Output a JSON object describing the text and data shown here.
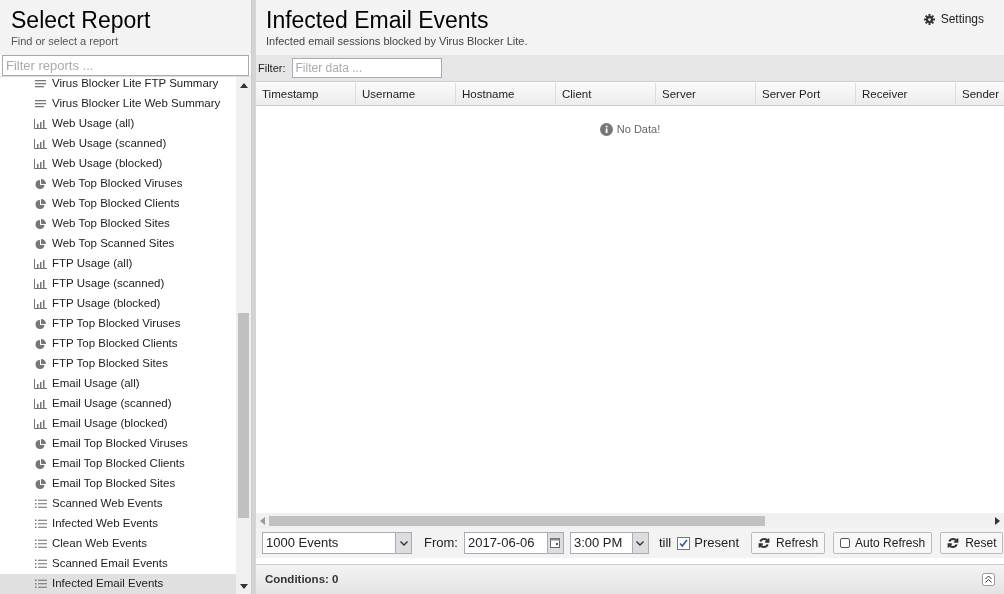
{
  "sidebar": {
    "title": "Select Report",
    "subtitle": "Find or select a report",
    "filter": {
      "placeholder": "Filter reports ..."
    },
    "items": [
      {
        "label": "Virus Blocker Lite FTP Summary",
        "kind": "summary",
        "selected": false
      },
      {
        "label": "Virus Blocker Lite Web Summary",
        "kind": "summary",
        "selected": false
      },
      {
        "label": "Web Usage (all)",
        "kind": "bar",
        "selected": false
      },
      {
        "label": "Web Usage (scanned)",
        "kind": "bar",
        "selected": false
      },
      {
        "label": "Web Usage (blocked)",
        "kind": "bar",
        "selected": false
      },
      {
        "label": "Web Top Blocked Viruses",
        "kind": "pie",
        "selected": false
      },
      {
        "label": "Web Top Blocked Clients",
        "kind": "pie",
        "selected": false
      },
      {
        "label": "Web Top Blocked Sites",
        "kind": "pie",
        "selected": false
      },
      {
        "label": "Web Top Scanned Sites",
        "kind": "pie",
        "selected": false
      },
      {
        "label": "FTP Usage (all)",
        "kind": "bar",
        "selected": false
      },
      {
        "label": "FTP Usage (scanned)",
        "kind": "bar",
        "selected": false
      },
      {
        "label": "FTP Usage (blocked)",
        "kind": "bar",
        "selected": false
      },
      {
        "label": "FTP Top Blocked Viruses",
        "kind": "pie",
        "selected": false
      },
      {
        "label": "FTP Top Blocked Clients",
        "kind": "pie",
        "selected": false
      },
      {
        "label": "FTP Top Blocked Sites",
        "kind": "pie",
        "selected": false
      },
      {
        "label": "Email Usage (all)",
        "kind": "bar",
        "selected": false
      },
      {
        "label": "Email Usage (scanned)",
        "kind": "bar",
        "selected": false
      },
      {
        "label": "Email Usage (blocked)",
        "kind": "bar",
        "selected": false
      },
      {
        "label": "Email Top Blocked Viruses",
        "kind": "pie",
        "selected": false
      },
      {
        "label": "Email Top Blocked Clients",
        "kind": "pie",
        "selected": false
      },
      {
        "label": "Email Top Blocked Sites",
        "kind": "pie",
        "selected": false
      },
      {
        "label": "Scanned Web Events",
        "kind": "list",
        "selected": false
      },
      {
        "label": "Infected Web Events",
        "kind": "list",
        "selected": false
      },
      {
        "label": "Clean Web Events",
        "kind": "list",
        "selected": false
      },
      {
        "label": "Scanned Email Events",
        "kind": "list",
        "selected": false
      },
      {
        "label": "Infected Email Events",
        "kind": "list",
        "selected": true
      }
    ]
  },
  "report": {
    "title": "Infected Email Events",
    "description": "Infected email sessions blocked by Virus Blocker Lite.",
    "settings": "Settings",
    "filter": {
      "label": "Filter:",
      "placeholder": "Filter data ..."
    },
    "columns": [
      "Timestamp",
      "Username",
      "Hostname",
      "Client",
      "Server",
      "Server Port",
      "Receiver",
      "Sender"
    ],
    "empty": "No Data!",
    "toolbar": {
      "limit": "1000 Events",
      "from_label": "From:",
      "date": "2017-06-06",
      "time": "3:00 PM",
      "till": "till",
      "present": {
        "label": "Present",
        "checked": true
      },
      "refresh": "Refresh",
      "auto_refresh": {
        "label": "Auto Refresh",
        "checked": false
      },
      "reset": "Reset"
    },
    "conditions": "Conditions: 0"
  }
}
